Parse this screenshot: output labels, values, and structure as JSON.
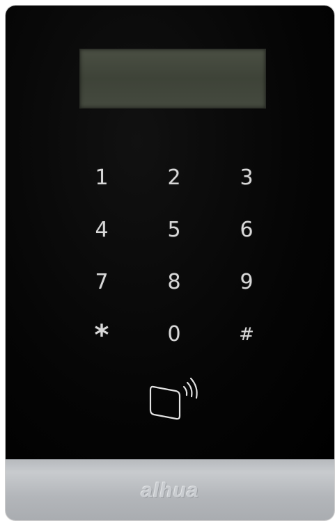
{
  "keypad": {
    "keys": [
      "1",
      "2",
      "3",
      "4",
      "5",
      "6",
      "7",
      "8",
      "9",
      "*",
      "0",
      "#"
    ]
  },
  "icons": {
    "card_reader": "contactless-card-icon"
  },
  "brand": {
    "logo_text": "alhua"
  },
  "colors": {
    "panel": "#000000",
    "lcd": "#41463b",
    "key_text": "#d8d8d8",
    "bezel": "#b7babe"
  }
}
